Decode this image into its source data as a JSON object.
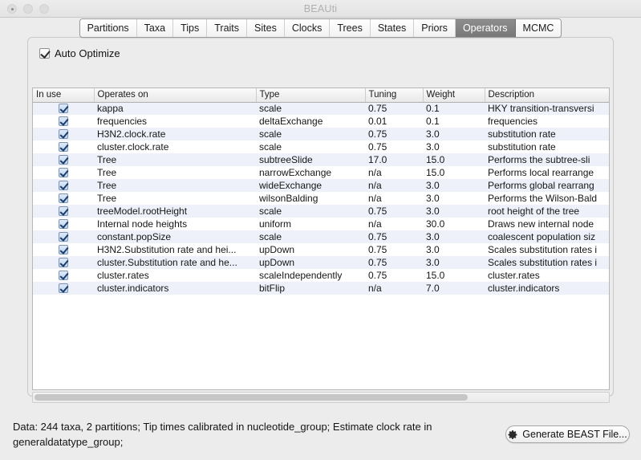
{
  "window": {
    "title": "BEAUti",
    "traffic_lights": [
      "close-button",
      "minimize-button",
      "zoom-button"
    ]
  },
  "tabs": [
    {
      "label": "Partitions",
      "selected": false
    },
    {
      "label": "Taxa",
      "selected": false
    },
    {
      "label": "Tips",
      "selected": false
    },
    {
      "label": "Traits",
      "selected": false
    },
    {
      "label": "Sites",
      "selected": false
    },
    {
      "label": "Clocks",
      "selected": false
    },
    {
      "label": "Trees",
      "selected": false
    },
    {
      "label": "States",
      "selected": false
    },
    {
      "label": "Priors",
      "selected": false
    },
    {
      "label": "Operators",
      "selected": true
    },
    {
      "label": "MCMC",
      "selected": false
    }
  ],
  "options": {
    "auto_optimize_label": "Auto Optimize",
    "auto_optimize_checked": true
  },
  "table": {
    "columns": [
      "In use",
      "Operates on",
      "Type",
      "Tuning",
      "Weight",
      "Description"
    ],
    "rows": [
      {
        "in_use": true,
        "operates_on": "kappa",
        "type": "scale",
        "tuning": "0.75",
        "weight": "0.1",
        "description": "HKY transition-transversi"
      },
      {
        "in_use": true,
        "operates_on": "frequencies",
        "type": "deltaExchange",
        "tuning": "0.01",
        "weight": "0.1",
        "description": "frequencies"
      },
      {
        "in_use": true,
        "operates_on": "H3N2.clock.rate",
        "type": "scale",
        "tuning": "0.75",
        "weight": "3.0",
        "description": "substitution rate"
      },
      {
        "in_use": true,
        "operates_on": "cluster.clock.rate",
        "type": "scale",
        "tuning": "0.75",
        "weight": "3.0",
        "description": "substitution rate"
      },
      {
        "in_use": true,
        "operates_on": "Tree",
        "type": "subtreeSlide",
        "tuning": "17.0",
        "weight": "15.0",
        "description": "Performs the subtree-sli"
      },
      {
        "in_use": true,
        "operates_on": "Tree",
        "type": "narrowExchange",
        "tuning": "n/a",
        "weight": "15.0",
        "description": "Performs local rearrange"
      },
      {
        "in_use": true,
        "operates_on": "Tree",
        "type": "wideExchange",
        "tuning": "n/a",
        "weight": "3.0",
        "description": "Performs global rearrang"
      },
      {
        "in_use": true,
        "operates_on": "Tree",
        "type": "wilsonBalding",
        "tuning": "n/a",
        "weight": "3.0",
        "description": "Performs the Wilson-Bald"
      },
      {
        "in_use": true,
        "operates_on": "treeModel.rootHeight",
        "type": "scale",
        "tuning": "0.75",
        "weight": "3.0",
        "description": "root height of the tree"
      },
      {
        "in_use": true,
        "operates_on": "Internal node heights",
        "type": "uniform",
        "tuning": "n/a",
        "weight": "30.0",
        "description": "Draws new internal node"
      },
      {
        "in_use": true,
        "operates_on": "constant.popSize",
        "type": "scale",
        "tuning": "0.75",
        "weight": "3.0",
        "description": "coalescent population siz"
      },
      {
        "in_use": true,
        "operates_on": "H3N2.Substitution rate and hei...",
        "type": "upDown",
        "tuning": "0.75",
        "weight": "3.0",
        "description": "Scales substitution rates i"
      },
      {
        "in_use": true,
        "operates_on": "cluster.Substitution rate and he...",
        "type": "upDown",
        "tuning": "0.75",
        "weight": "3.0",
        "description": "Scales substitution rates i"
      },
      {
        "in_use": true,
        "operates_on": "cluster.rates",
        "type": "scaleIndependently",
        "tuning": "0.75",
        "weight": "15.0",
        "description": "cluster.rates"
      },
      {
        "in_use": true,
        "operates_on": "cluster.indicators",
        "type": "bitFlip",
        "tuning": "n/a",
        "weight": "7.0",
        "description": "cluster.indicators"
      }
    ]
  },
  "status": {
    "text": "Data: 244 taxa, 2 partitions; Tip times calibrated in nucleotide_group; Estimate clock rate in generaldatatype_group;"
  },
  "actions": {
    "generate_label": "Generate BEAST File...",
    "generate_icon": "gear-icon"
  },
  "colors": {
    "selected_tab_bg": "#787878",
    "row_stripe": "#eef1fa",
    "window_bg": "#ececec"
  }
}
